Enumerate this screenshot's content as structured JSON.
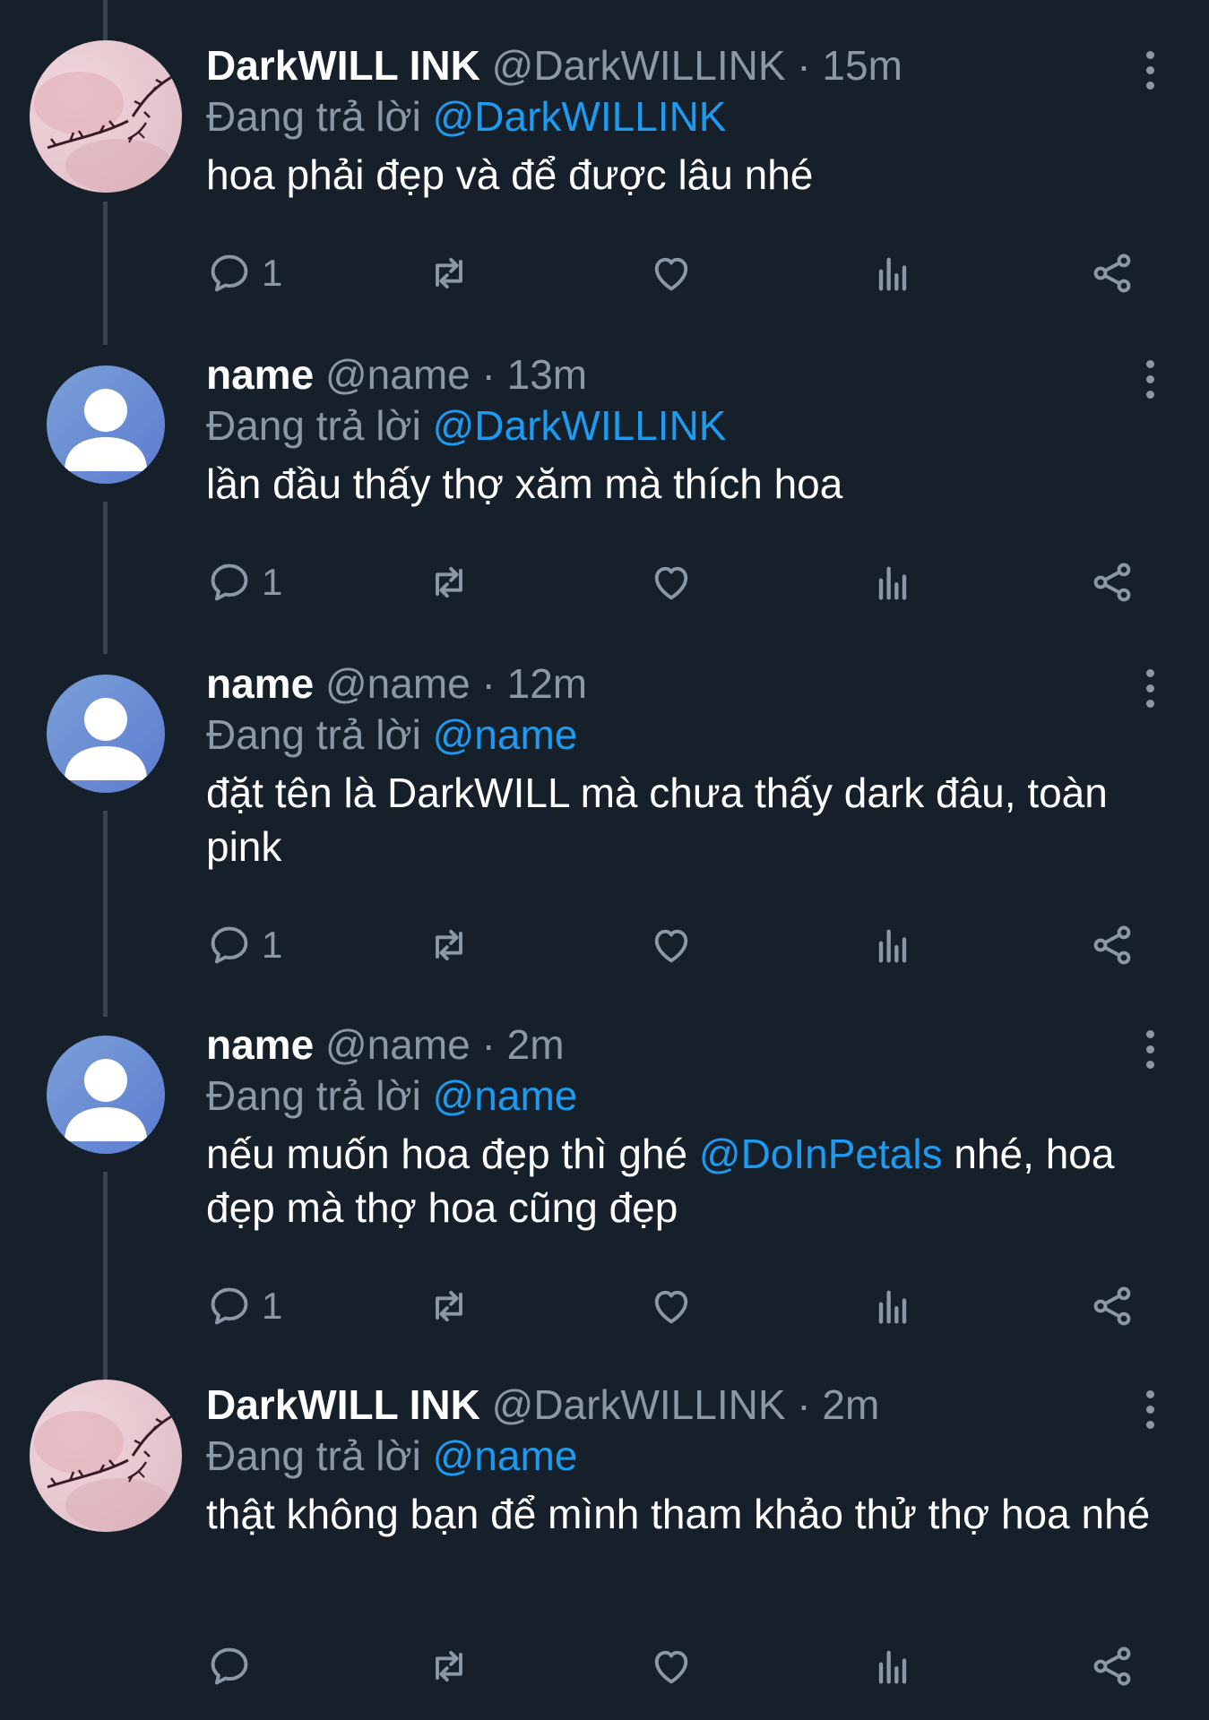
{
  "reply_prefix": "Đang trả lời",
  "tweets": [
    {
      "name": "DarkWILL INK",
      "handle": "@DarkWILLINK",
      "sep": "·",
      "time": "15m",
      "reply_to": "@DarkWILLINK",
      "body_before": "hoa phải đẹp và để được lâu nhé",
      "body_mention": "",
      "body_after": "",
      "reply_count": "1",
      "avatar": "tattoo-photo"
    },
    {
      "name": "name",
      "handle": "@name",
      "sep": "·",
      "time": "13m",
      "reply_to": "@DarkWILLINK",
      "body_before": "lần đầu thấy thợ xăm mà thích hoa",
      "body_mention": "",
      "body_after": "",
      "reply_count": "1",
      "avatar": "default-user-icon"
    },
    {
      "name": "name",
      "handle": "@name",
      "sep": "·",
      "time": "12m",
      "reply_to": "@name",
      "body_before": "đặt tên là DarkWILL mà chưa thấy dark đâu, toàn pink",
      "body_mention": "",
      "body_after": "",
      "reply_count": "1",
      "avatar": "default-user-icon"
    },
    {
      "name": "name",
      "handle": "@name",
      "sep": "·",
      "time": "2m",
      "reply_to": "@name",
      "body_before": "nếu muốn hoa đẹp thì ghé ",
      "body_mention": "@DoInPetals",
      "body_after": " nhé, hoa đẹp mà thợ hoa cũng đẹp",
      "reply_count": "1",
      "avatar": "default-user-icon"
    },
    {
      "name": "DarkWILL INK",
      "handle": "@DarkWILLINK",
      "sep": "·",
      "time": "2m",
      "reply_to": "@name",
      "body_before": "thật không bạn để mình tham khảo thử thợ hoa nhé",
      "body_mention": "",
      "body_after": "",
      "reply_count": "",
      "avatar": "tattoo-photo"
    }
  ],
  "colors": {
    "background": "#15202b",
    "secondary_text": "#8b98a5",
    "link": "#1d9bf0",
    "thread_line": "#38444d"
  }
}
